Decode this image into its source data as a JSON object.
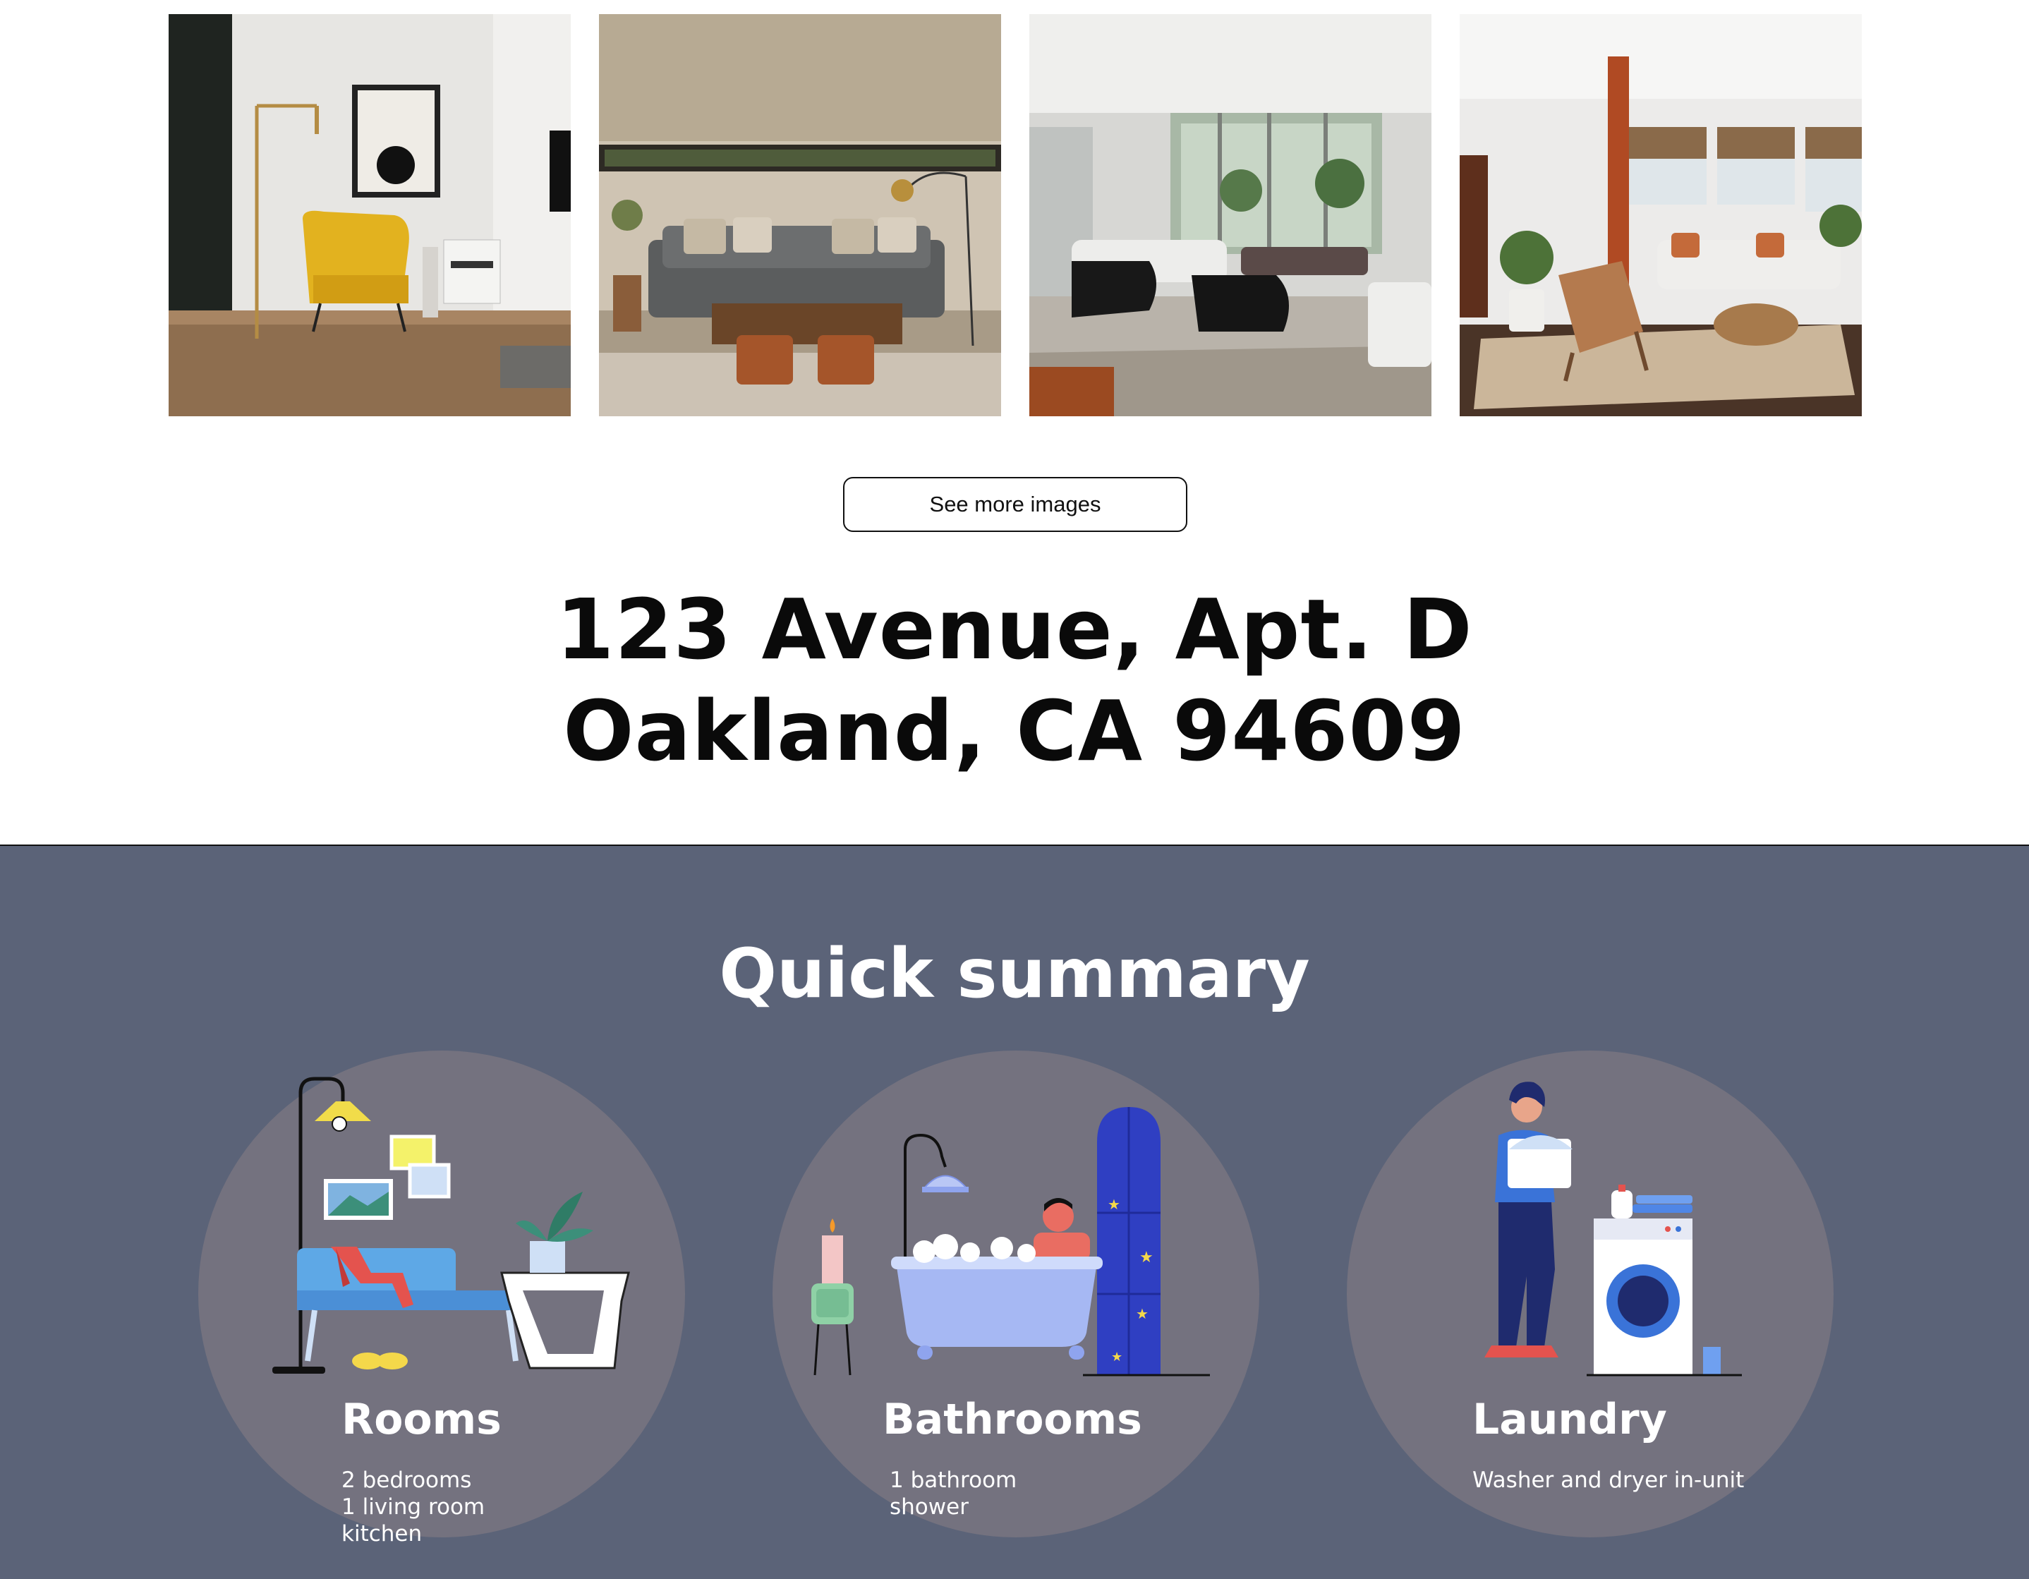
{
  "gallery": {
    "photos": [
      "living-room-photo-yellow-chair",
      "living-room-photo-grey-sofa",
      "living-room-photo-black-armchairs",
      "living-room-photo-bay-window"
    ]
  },
  "actions": {
    "see_more_label": "See more images"
  },
  "address": {
    "line1": "123 Avenue, Apt. D",
    "line2": "Oakland, CA 94609"
  },
  "summary": {
    "title": "Quick summary",
    "cards": [
      {
        "title": "Rooms",
        "lines": [
          "2 bedrooms",
          "1 living room",
          "kitchen"
        ],
        "icon": "living-room-illustration"
      },
      {
        "title": "Bathrooms",
        "lines": [
          "1 bathroom",
          "shower"
        ],
        "icon": "bathtub-illustration"
      },
      {
        "title": "Laundry",
        "lines": [
          "Washer and dryer in-unit"
        ],
        "icon": "washing-machine-illustration"
      }
    ]
  },
  "colors": {
    "summary_bg": "#5b6378",
    "circle": "#74727f",
    "text_dark": "#0a0a0a"
  }
}
